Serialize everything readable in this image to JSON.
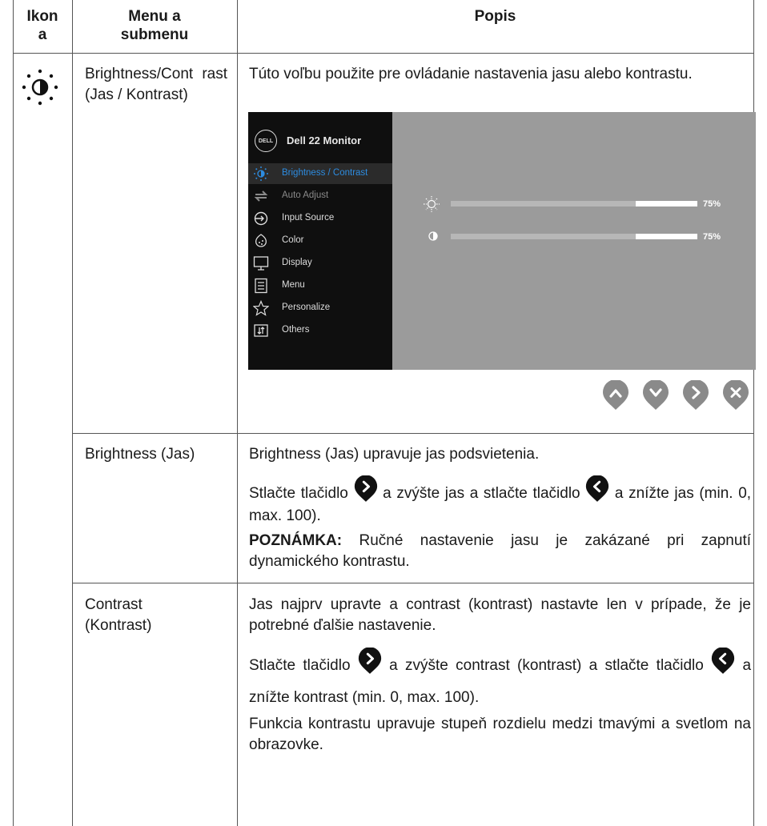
{
  "table": {
    "headers": {
      "icon": "Ikon\na",
      "menu": "Menu a\nsubmenu",
      "desc": "Popis"
    }
  },
  "row1": {
    "menu": "Brightness/Cont rast (Jas / Kontrast)",
    "desc": "Túto voľbu použite pre ovládanie nastavenia jasu alebo kontrastu."
  },
  "osd": {
    "logo": "DELL",
    "title": "Dell 22 Monitor",
    "menu": [
      {
        "label": "Brightness / Contrast",
        "icon": "brightness-icon",
        "state": "active"
      },
      {
        "label": "Auto Adjust",
        "icon": "auto-adjust-icon",
        "state": "dim"
      },
      {
        "label": "Input Source",
        "icon": "input-source-icon",
        "state": "normal"
      },
      {
        "label": "Color",
        "icon": "color-icon",
        "state": "normal"
      },
      {
        "label": "Display",
        "icon": "display-icon",
        "state": "normal"
      },
      {
        "label": "Menu",
        "icon": "menu-icon",
        "state": "normal"
      },
      {
        "label": "Personalize",
        "icon": "star-icon",
        "state": "normal"
      },
      {
        "label": "Others",
        "icon": "others-icon",
        "state": "normal"
      }
    ],
    "brightness": {
      "value": 75,
      "label": "75%"
    },
    "contrast": {
      "value": 75,
      "label": "75%"
    },
    "buttons": [
      "up-icon",
      "down-icon",
      "right-icon",
      "close-icon"
    ]
  },
  "row2": {
    "menu": "Brightness (Jas)",
    "p1": "Brightness (Jas) upravuje jas podsvietenia.",
    "p2a": "Stlačte tlačidlo",
    "p2b": "a zvýšte jas a stlačte tlačidlo",
    "p2c": "a znížte jas (min. 0, max. 100).",
    "note_label": "POZNÁMKA:",
    "note": "Ručné nastavenie jasu je zakázané pri zapnutí dynamického kontrastu."
  },
  "row3": {
    "menu": "Contrast (Kontrast)",
    "p1": "Jas najprv upravte a contrast (kontrast) nastavte len v prípade, že je potrebné ďalšie nastavenie.",
    "p2a": "Stlačte tlačidlo",
    "p2b": "a zvýšte contrast (kontrast) a stlačte tlačidlo",
    "p2c": "a znížte kontrast (min. 0, max. 100).",
    "p3": "Funkcia kontrastu upravuje stupeň rozdielu medzi tmavými a svetlom na obrazovke."
  }
}
